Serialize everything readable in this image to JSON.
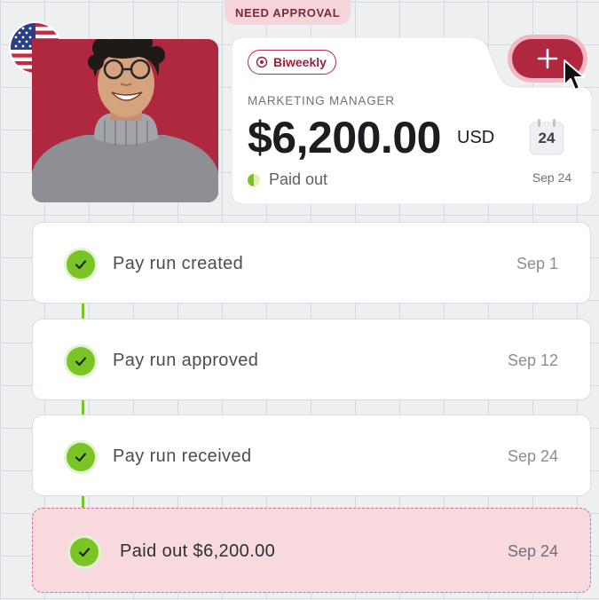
{
  "badge": {
    "label": "NEED APPROVAL"
  },
  "profile": {
    "flag_icon": "us-flag-icon",
    "photo_bg": "#b0283f"
  },
  "card": {
    "frequency": "Biweekly",
    "role": "MARKETING MANAGER",
    "amount": "$6,200.00",
    "currency": "USD",
    "status": "Paid out",
    "calendar_day": "24",
    "date": "Sep 24"
  },
  "actions": {
    "add_icon": "plus-icon"
  },
  "timeline": {
    "steps": [
      {
        "label": "Pay run created",
        "date": "Sep 1"
      },
      {
        "label": "Pay run approved",
        "date": "Sep 12"
      },
      {
        "label": "Pay run received",
        "date": "Sep 24"
      },
      {
        "label": "Paid out $6,200.00",
        "date": "Sep 24"
      }
    ]
  },
  "colors": {
    "accent": "#b0283f",
    "success": "#7ac426",
    "highlight_bg": "#f8d9de"
  }
}
